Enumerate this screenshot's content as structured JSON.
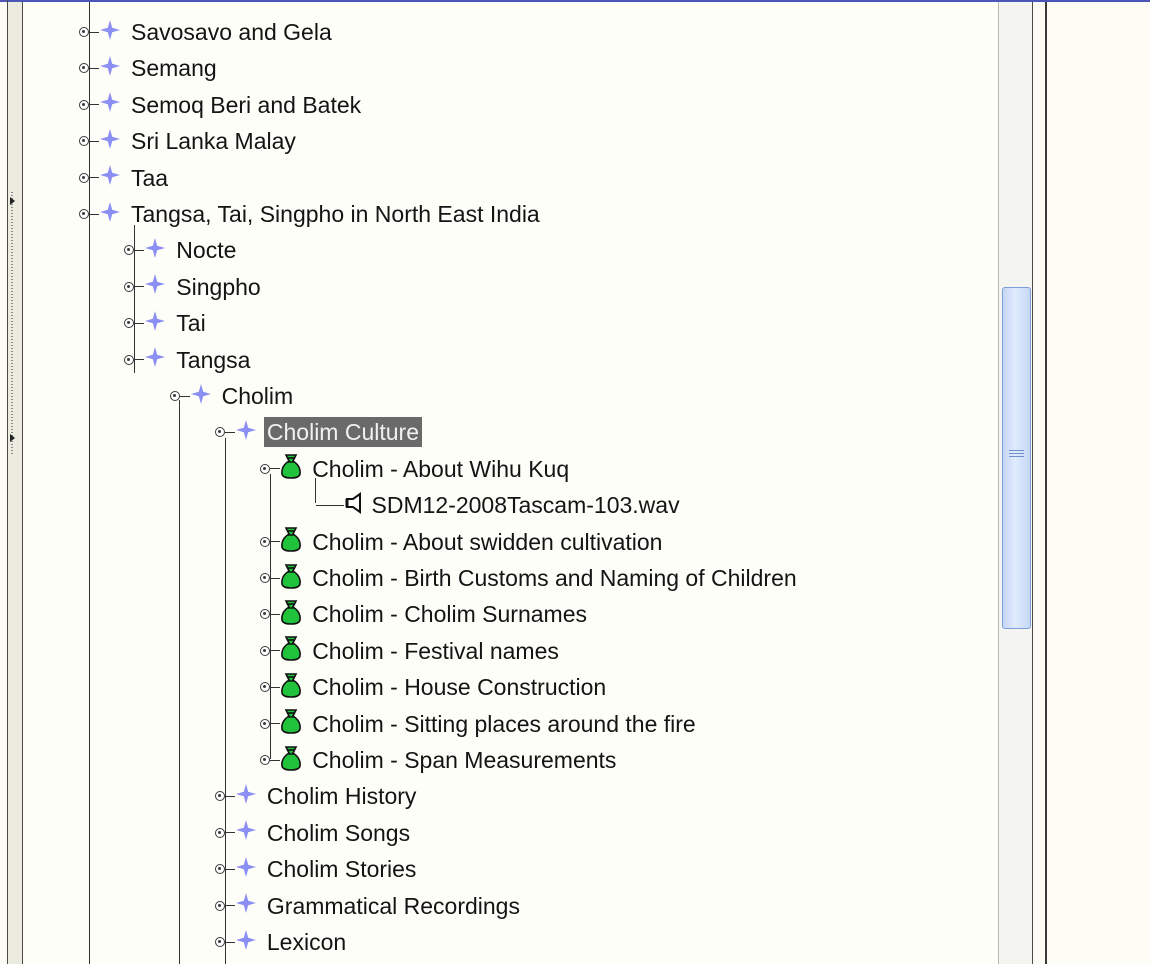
{
  "tree": {
    "nodes": [
      {
        "label": "Savosavo and Gela",
        "icon": "collection-diamond-icon"
      },
      {
        "label": "Semang",
        "icon": "collection-diamond-icon"
      },
      {
        "label": "Semoq Beri and Batek",
        "icon": "collection-diamond-icon"
      },
      {
        "label": "Sri Lanka Malay",
        "icon": "collection-diamond-icon"
      },
      {
        "label": "Taa",
        "icon": "collection-diamond-icon"
      },
      {
        "label": "Tangsa, Tai, Singpho in North East India",
        "icon": "collection-diamond-icon",
        "expanded": true
      },
      {
        "label": "Nocte",
        "icon": "collection-diamond-icon"
      },
      {
        "label": "Singpho",
        "icon": "collection-diamond-icon"
      },
      {
        "label": "Tai",
        "icon": "collection-diamond-icon"
      },
      {
        "label": "Tangsa",
        "icon": "collection-diamond-icon",
        "expanded": true
      },
      {
        "label": "Cholim",
        "icon": "collection-diamond-icon",
        "expanded": true
      },
      {
        "label": "Cholim Culture",
        "icon": "collection-diamond-icon",
        "expanded": true,
        "selected": true
      },
      {
        "label": "Cholim - About Wihu Kuq",
        "icon": "bundle-icon",
        "expanded": true
      },
      {
        "label": "SDM12-2008Tascam-103.wav",
        "icon": "speaker-icon"
      },
      {
        "label": "Cholim - About swidden cultivation",
        "icon": "bundle-icon"
      },
      {
        "label": "Cholim - Birth Customs and Naming of Children",
        "icon": "bundle-icon"
      },
      {
        "label": "Cholim - Cholim Surnames",
        "icon": "bundle-icon"
      },
      {
        "label": "Cholim - Festival names",
        "icon": "bundle-icon"
      },
      {
        "label": "Cholim - House Construction",
        "icon": "bundle-icon"
      },
      {
        "label": "Cholim - Sitting places around the fire",
        "icon": "bundle-icon"
      },
      {
        "label": "Cholim - Span Measurements",
        "icon": "bundle-icon"
      },
      {
        "label": "Cholim History",
        "icon": "collection-diamond-icon"
      },
      {
        "label": "Cholim Songs",
        "icon": "collection-diamond-icon"
      },
      {
        "label": "Cholim Stories",
        "icon": "collection-diamond-icon"
      },
      {
        "label": "Grammatical Recordings",
        "icon": "collection-diamond-icon"
      },
      {
        "label": "Lexicon",
        "icon": "collection-diamond-icon"
      }
    ]
  },
  "colors": {
    "diamond": "#8b8ef2",
    "bundle": "#21c33d",
    "selection_bg": "#6a6a6a",
    "scroll_thumb": "#d4e2fa"
  }
}
